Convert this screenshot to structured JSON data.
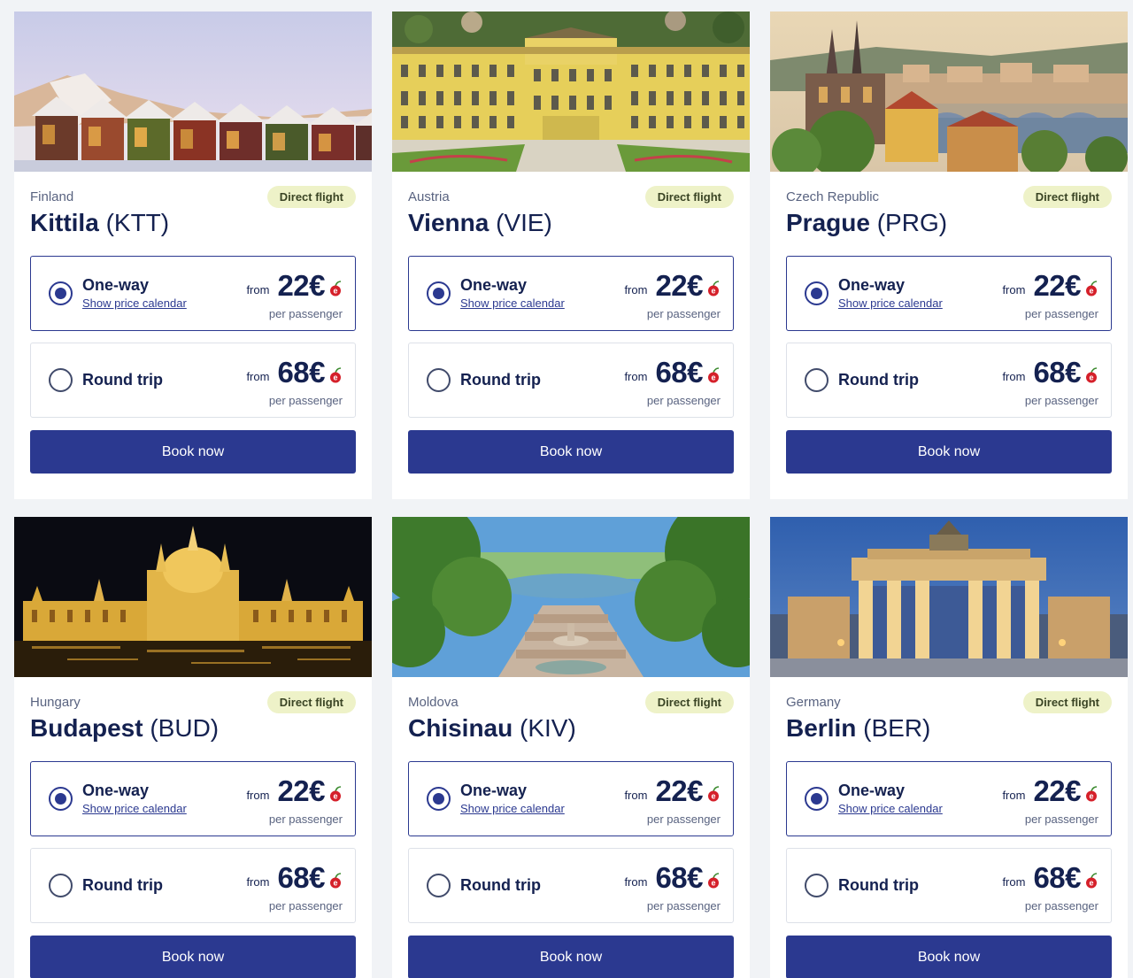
{
  "labels": {
    "badge": "Direct flight",
    "one_way": "One-way",
    "round_trip": "Round trip",
    "calendar_link": "Show price calendar",
    "from": "from",
    "per_passenger": "per passenger",
    "book_now": "Book now"
  },
  "prices": {
    "one_way": "22€",
    "round_trip": "68€"
  },
  "colors": {
    "primary": "#2b3990",
    "badge_bg": "#eef2c8",
    "page_bg": "#f1f3f6"
  },
  "selected_option": "one-way",
  "cards": [
    {
      "country": "Finland",
      "city": "Kittila",
      "code": "(KTT)"
    },
    {
      "country": "Austria",
      "city": "Vienna",
      "code": "(VIE)"
    },
    {
      "country": "Czech Republic",
      "city": "Prague",
      "code": "(PRG)"
    },
    {
      "country": "Hungary",
      "city": "Budapest",
      "code": "(BUD)"
    },
    {
      "country": "Moldova",
      "city": "Chisinau",
      "code": "(KIV)"
    },
    {
      "country": "Germany",
      "city": "Berlin",
      "code": "(BER)"
    }
  ]
}
